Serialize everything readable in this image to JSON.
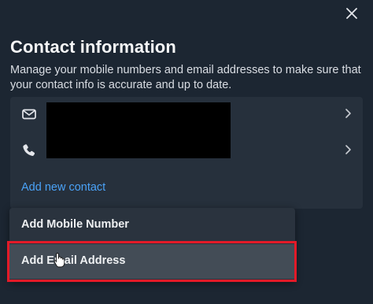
{
  "dialog": {
    "title": "Contact information",
    "description": "Manage your mobile numbers and email addresses to make sure that your contact info is accurate and up to date.",
    "close_icon": "close-icon"
  },
  "contacts": [
    {
      "type": "email",
      "icon": "mail-icon",
      "value": ""
    },
    {
      "type": "phone",
      "icon": "phone-icon",
      "value": ""
    }
  ],
  "add_contact_label": "Add new contact",
  "menu": {
    "items": [
      {
        "label": "Add Mobile Number"
      },
      {
        "label": "Add Email Address"
      }
    ]
  },
  "colors": {
    "background": "#1c2632",
    "card": "#26303c",
    "link": "#4aa2f7",
    "highlight": "#e31a28",
    "menu_hover": "#434c56"
  }
}
